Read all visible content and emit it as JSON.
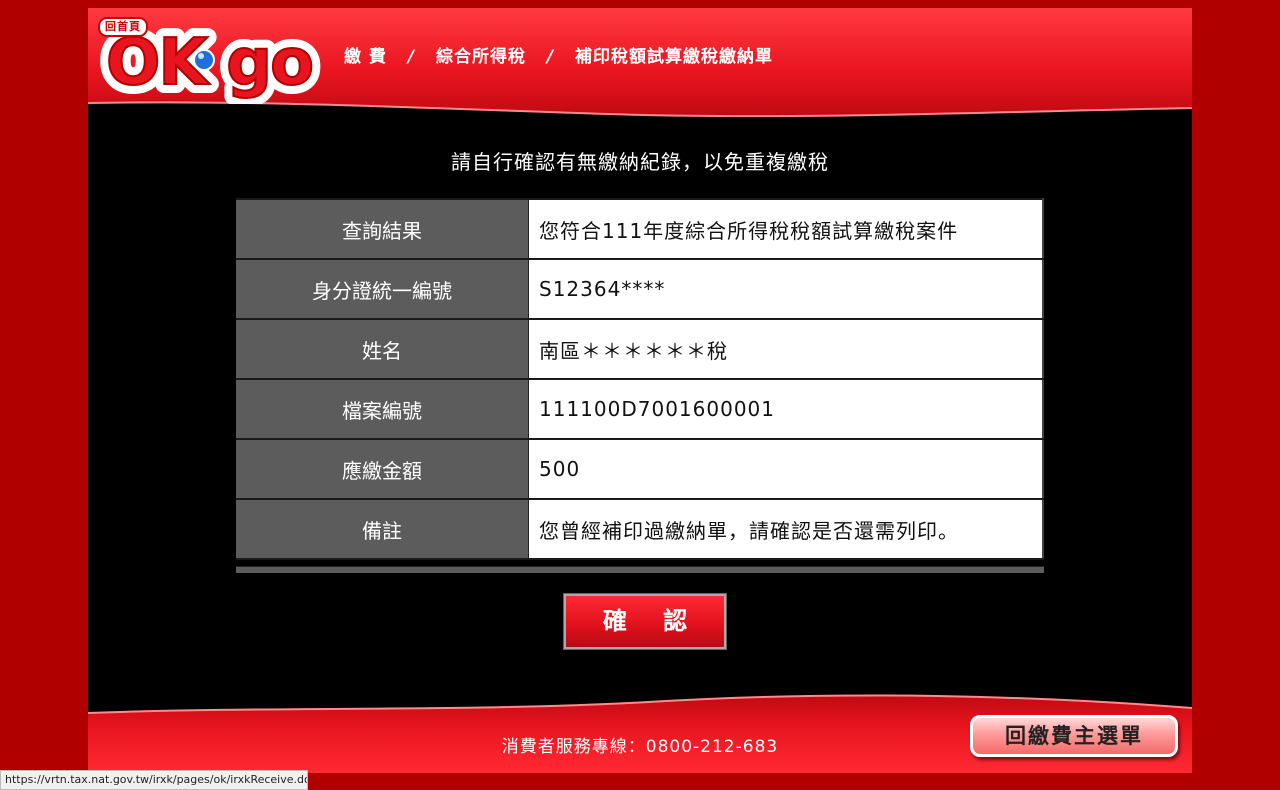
{
  "header": {
    "logo_text": "OK·go",
    "home_link": "回首頁",
    "breadcrumb": [
      "繳 費",
      "綜合所得稅",
      "補印稅額試算繳稅繳納單"
    ],
    "separator": "/"
  },
  "notice": "請自行確認有無繳納紀錄，以免重複繳稅",
  "result_table": [
    {
      "label": "查詢結果",
      "value": "您符合111年度綜合所得稅稅額試算繳稅案件"
    },
    {
      "label": "身分證統一編號",
      "value": "S12364****"
    },
    {
      "label": "姓名",
      "value": "南區＊＊＊＊＊＊稅"
    },
    {
      "label": "檔案編號",
      "value": "111100D7001600001"
    },
    {
      "label": "應繳金額",
      "value": "500"
    },
    {
      "label": "備註",
      "value": "您曾經補印過繳納單，請確認是否還需列印。"
    }
  ],
  "confirm_button": "確 認",
  "footer": {
    "hotline": "消費者服務專線：0800-212-683",
    "back_button": "回繳費主選單"
  },
  "status_bar": {
    "url": "https://vrtn.tax.nat.gov.tw/irxk/pages/ok/irxkReceive.do#"
  },
  "colors": {
    "brand_red": "#e8141f",
    "outer_dark_red": "#b00000",
    "content_black": "#000000",
    "label_cell_gray": "#5c5c5c",
    "logo_blue": "#1e6fd9"
  },
  "icons": {
    "logo": "okgo-logo",
    "logo_dot": "blue-ball-icon"
  }
}
